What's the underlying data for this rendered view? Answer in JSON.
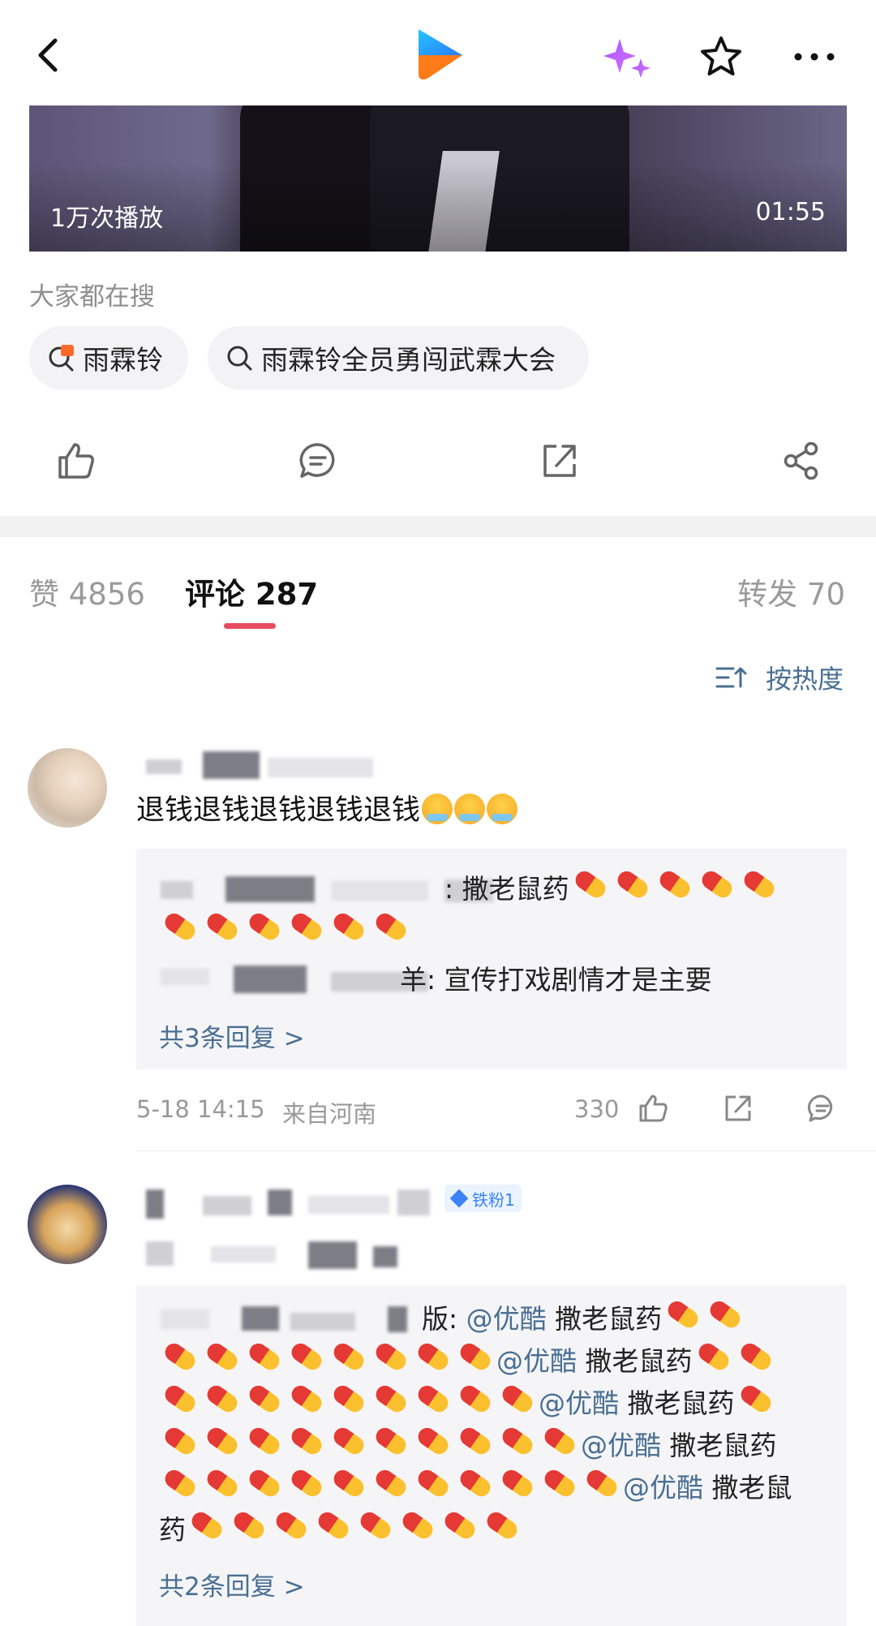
{
  "header": {
    "back_icon": "chevron-left-icon",
    "logo_icon": "youku-play-logo",
    "ai_icon": "sparkle-icon",
    "favorite_icon": "star-outline-icon",
    "more_icon": "ellipsis-icon"
  },
  "video": {
    "plays": "1万次播放",
    "duration": "01:55"
  },
  "search": {
    "label": "大家都在搜",
    "chips": [
      {
        "text": "雨霖铃",
        "icon": "hot-search-icon"
      },
      {
        "text": "雨霖铃全员勇闯武霖大会",
        "icon": "search-icon"
      }
    ]
  },
  "actions": {
    "icons": [
      "thumbs-up-icon",
      "comment-icon",
      "repost-icon",
      "share-icon"
    ]
  },
  "tabs": {
    "likes": "赞 4856",
    "comments": "评论 287",
    "reposts": "转发 70"
  },
  "sort": {
    "label": "按热度",
    "icon": "sort-icon"
  },
  "comments": [
    {
      "text": "退钱退钱退钱退钱退钱",
      "emoji_count": 3,
      "replies": [
        {
          "suffix": ": 撒老鼠药",
          "pill_count": 11
        },
        {
          "suffix": "羊: 宣传打戏剧情才是主要"
        }
      ],
      "total_replies": "共3条回复 >",
      "time": "5-18 14:15",
      "region": "来自河南",
      "likes": "330"
    },
    {
      "badge": "铁粉1",
      "reply_lines": [
        {
          "prefix": "版: ",
          "mention": "@优酷",
          "text": " 撒老鼠药",
          "pills_after": 2
        },
        {
          "pills_before": 8,
          "mention": "@优酷",
          "text": " 撒老鼠药",
          "pills_after": 2
        },
        {
          "pills_before": 9,
          "mention": "@优酷",
          "text": " 撒老鼠药",
          "pills_after": 1
        },
        {
          "pills_before": 10,
          "mention": "@优酷",
          "text": " 撒老鼠药"
        },
        {
          "pills_before": 11,
          "mention": "@优酷",
          "text": " 撒老鼠"
        },
        {
          "prefix": "药",
          "pills_after": 8
        }
      ],
      "total_replies": "共2条回复 >"
    }
  ]
}
